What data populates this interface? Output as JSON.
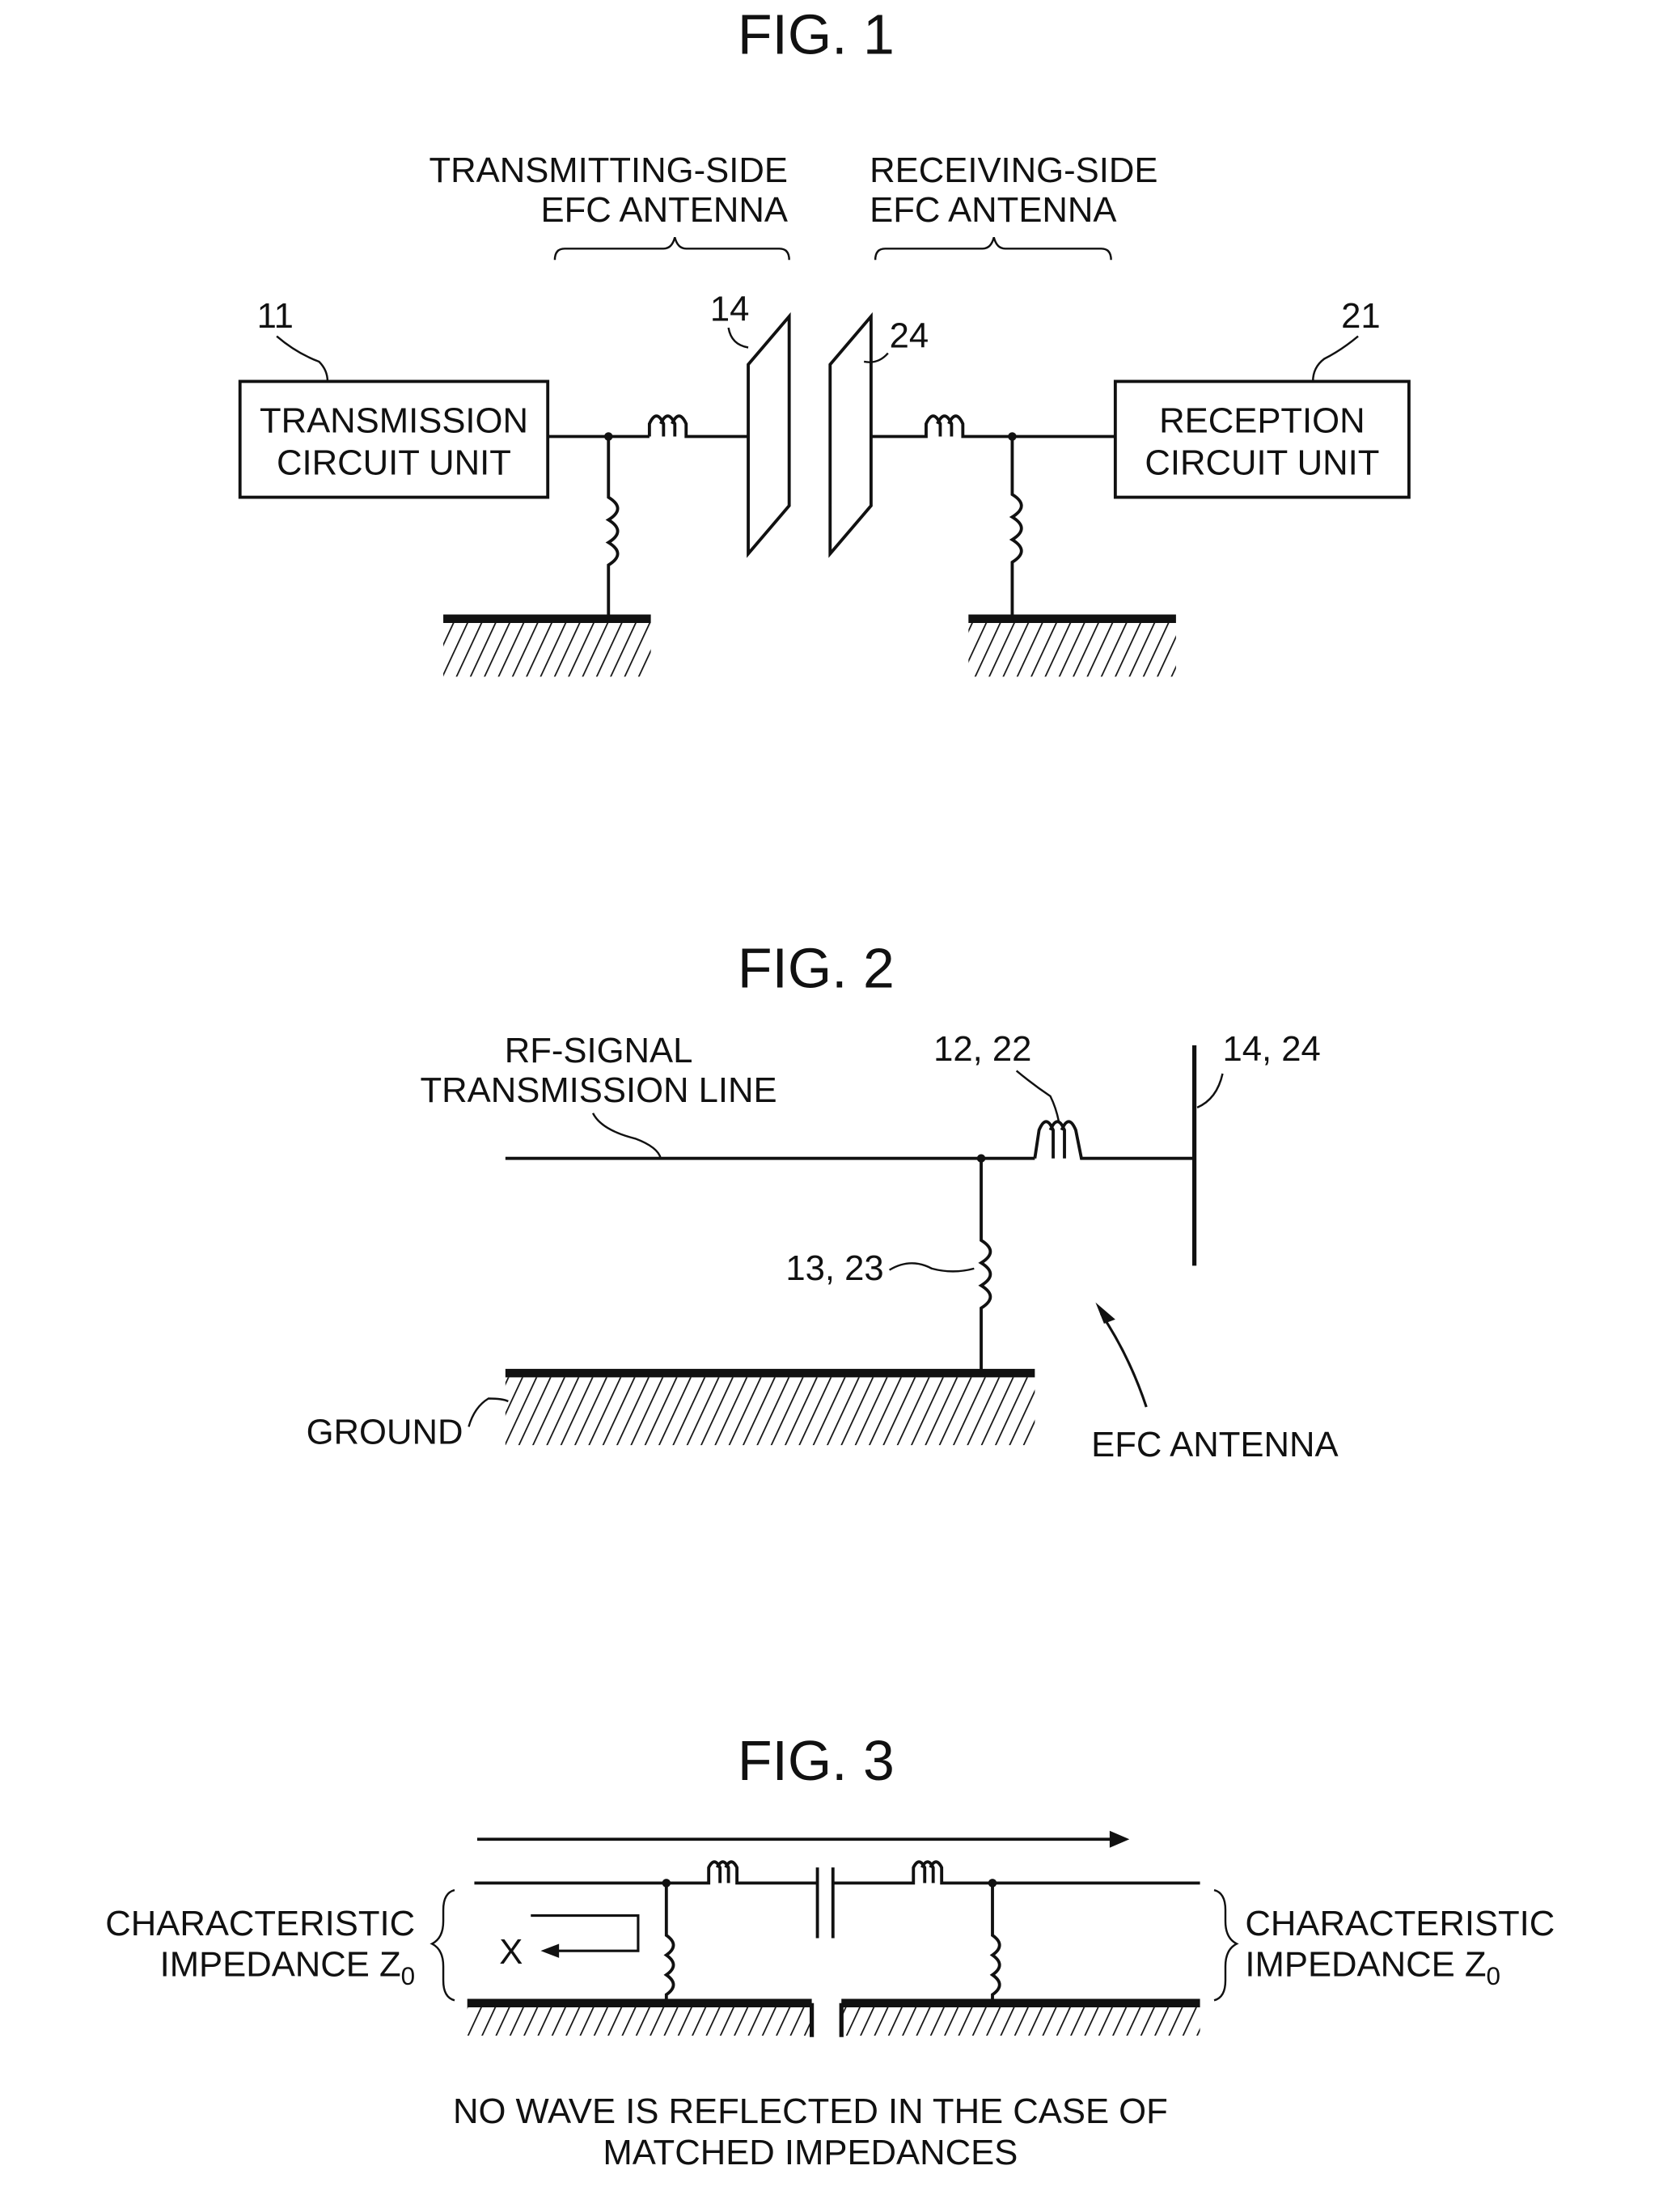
{
  "fig1": {
    "title": "FIG. 1",
    "tx_antenna_label": [
      "TRANSMITTING-SIDE",
      "EFC ANTENNA"
    ],
    "rx_antenna_label": [
      "RECEIVING-SIDE",
      "EFC ANTENNA"
    ],
    "tx_unit": [
      "TRANSMISSION",
      "CIRCUIT UNIT"
    ],
    "rx_unit": [
      "RECEPTION",
      "CIRCUIT UNIT"
    ],
    "refs": {
      "tx_unit": "11",
      "rx_unit": "21",
      "tx_electrode": "14",
      "rx_electrode": "24"
    }
  },
  "fig2": {
    "title": "FIG. 2",
    "line_label": [
      "RF-SIGNAL",
      "TRANSMISSION LINE"
    ],
    "series_inductor_ref": "12, 22",
    "electrode_ref": "14, 24",
    "parallel_inductor_ref": "13, 23",
    "ground_label": "GROUND",
    "antenna_label": "EFC ANTENNA"
  },
  "fig3": {
    "title": "FIG. 3",
    "left_label": [
      "CHARACTERISTIC",
      "IMPEDANCE Z"
    ],
    "right_label": [
      "CHARACTERISTIC",
      "IMPEDANCE Z"
    ],
    "subscript": "0",
    "reflect_mark": "X",
    "caption": [
      "NO WAVE IS REFLECTED IN THE CASE OF",
      "MATCHED IMPEDANCES"
    ]
  }
}
